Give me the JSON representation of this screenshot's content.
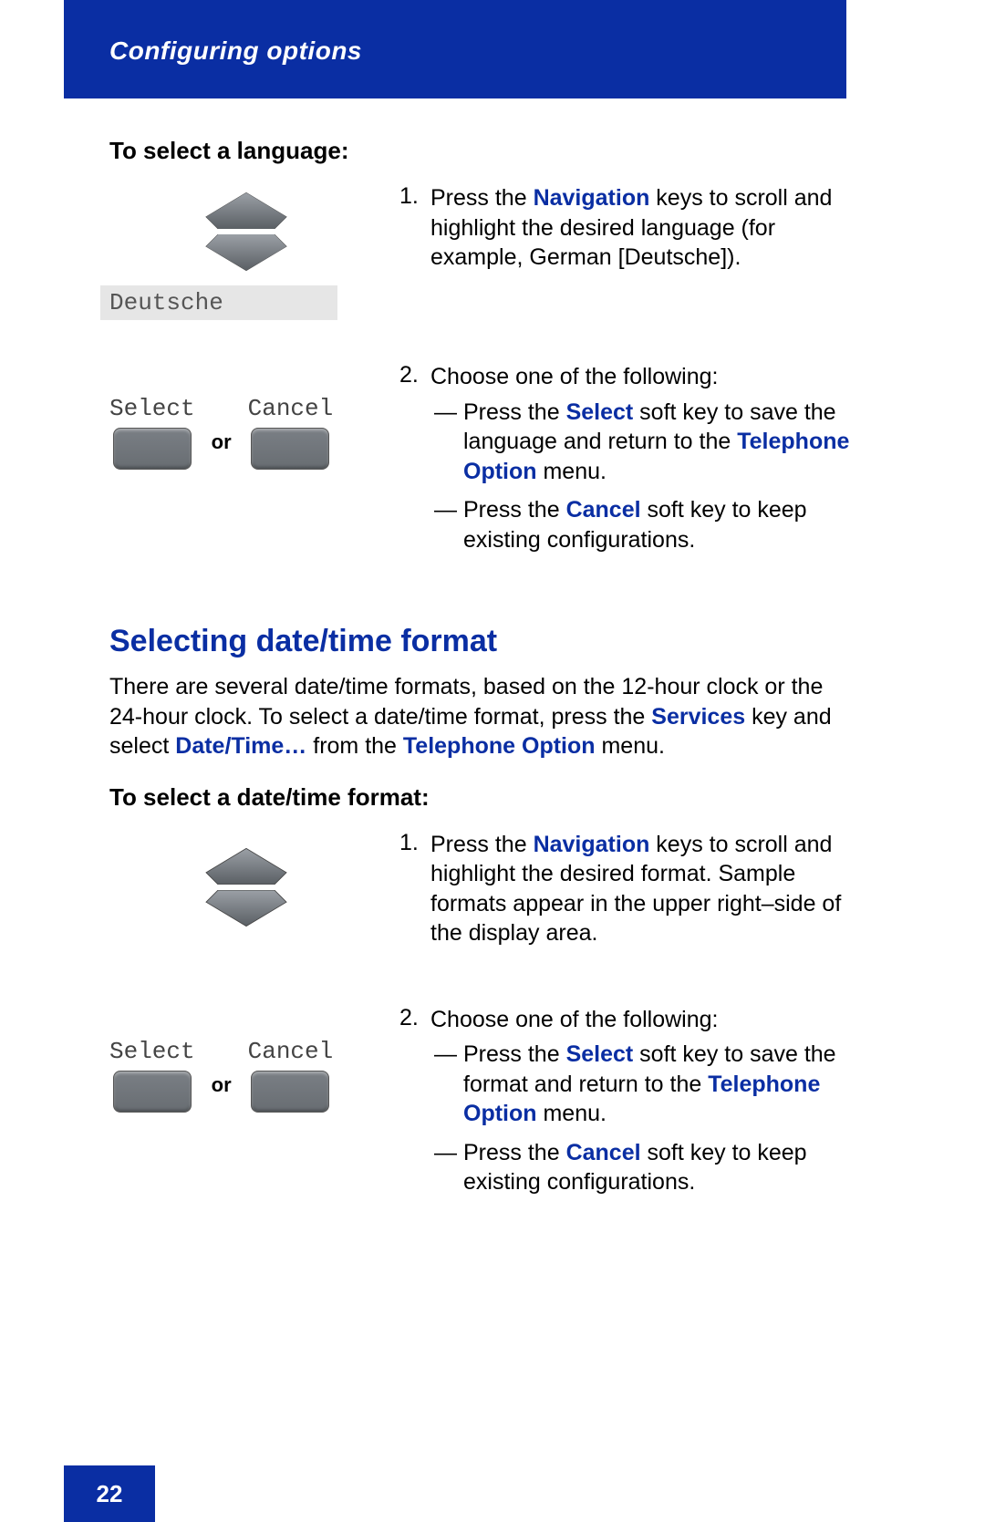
{
  "header": {
    "title": "Configuring options"
  },
  "section1": {
    "intro": "To select a language:",
    "langLabel": "Deutsche",
    "step1_num": "1.",
    "step1_a": "Press the ",
    "step1_b": "Navigation",
    "step1_c": " keys to scroll and highlight the desired language (for example, German [Deutsche]).",
    "step2_num": "2.",
    "step2_head": " Choose one of the following:",
    "step2_sub1_a": "Press the ",
    "step2_sub1_b": "Select",
    "step2_sub1_c": " soft key to save the language and return to the ",
    "step2_sub1_d": "Telephone Option",
    "step2_sub1_e": " menu.",
    "step2_sub2_a": "Press the ",
    "step2_sub2_b": "Cancel",
    "step2_sub2_c": " soft key to keep existing configurations.",
    "dash": "—",
    "softSelect": "Select",
    "softCancel": "Cancel",
    "or": "or"
  },
  "section2": {
    "heading": "Selecting date/time format",
    "para_a": "There are several date/time formats, based on the 12-hour clock or the 24-hour clock. To select a date/time format, press the ",
    "para_b": "Services",
    "para_c": " key and select ",
    "para_d": "Date/Time…",
    "para_e": " from the ",
    "para_f": "Telephone Option",
    "para_g": " menu.",
    "intro": "To select a date/time format:",
    "step1_num": "1.",
    "step1_a": "Press the ",
    "step1_b": "Navigation",
    "step1_c": " keys to scroll and highlight the desired format. Sample formats appear in the upper right–side of the display area.",
    "step2_num": "2.",
    "step2_head": "Choose one of the following:",
    "step2_sub1_a": "Press the ",
    "step2_sub1_b": "Select",
    "step2_sub1_c": " soft key to save the format and return to the ",
    "step2_sub1_d": "Telephone Option",
    "step2_sub1_e": " menu.",
    "step2_sub2_a": "Press the ",
    "step2_sub2_b": "Cancel",
    "step2_sub2_c": " soft key to keep existing configurations.",
    "dash": "—",
    "softSelect": "Select",
    "softCancel": "Cancel",
    "or": "or"
  },
  "footer": {
    "page": "22"
  }
}
